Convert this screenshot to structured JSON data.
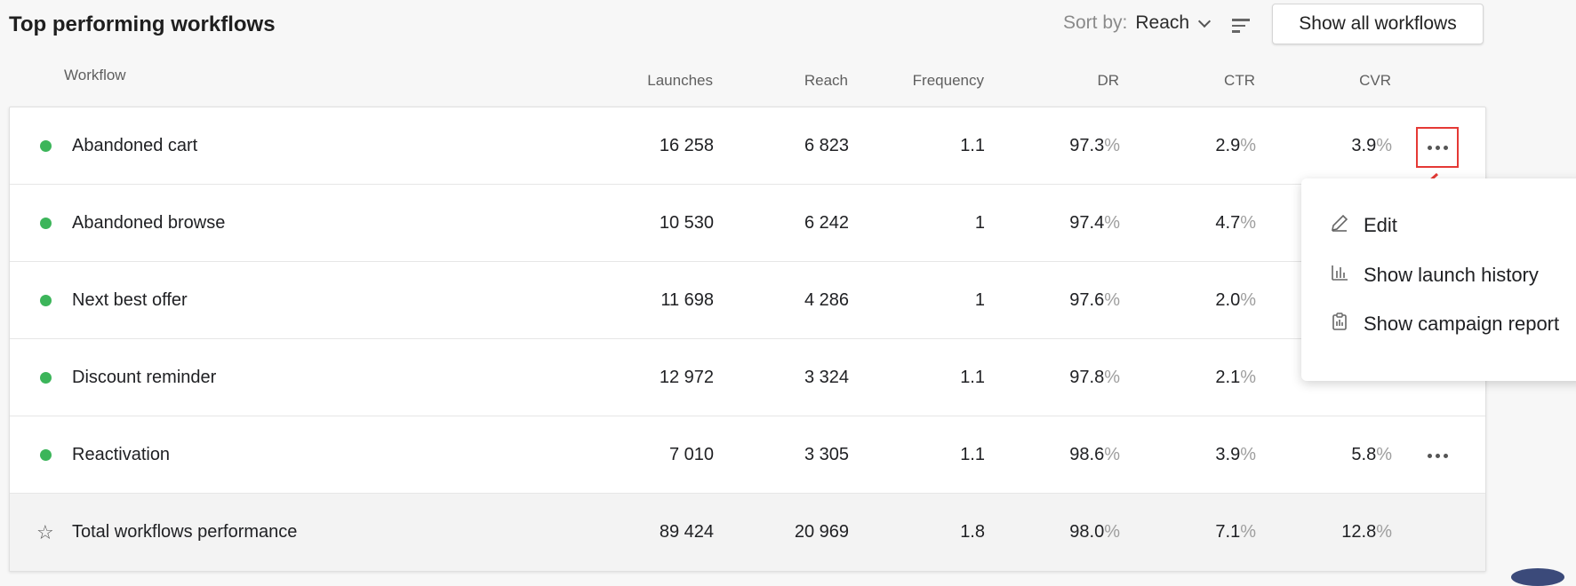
{
  "header": {
    "title": "Top performing workflows",
    "sort_label": "Sort by:",
    "sort_value": "Reach",
    "show_all": "Show all workflows"
  },
  "columns": {
    "workflow": "Workflow",
    "launches": "Launches",
    "reach": "Reach",
    "frequency": "Frequency",
    "dr": "DR",
    "ctr": "CTR",
    "cvr": "CVR"
  },
  "rows": [
    {
      "name": "Abandoned cart",
      "launches": "16 258",
      "reach": "6 823",
      "frequency": "1.1",
      "dr": "97.3",
      "ctr": "2.9",
      "cvr": "3.9"
    },
    {
      "name": "Abandoned browse",
      "launches": "10 530",
      "reach": "6 242",
      "frequency": "1",
      "dr": "97.4",
      "ctr": "4.7",
      "cvr": ""
    },
    {
      "name": "Next best offer",
      "launches": "11 698",
      "reach": "4 286",
      "frequency": "1",
      "dr": "97.6",
      "ctr": "2.0",
      "cvr": ""
    },
    {
      "name": "Discount reminder",
      "launches": "12 972",
      "reach": "3 324",
      "frequency": "1.1",
      "dr": "97.8",
      "ctr": "2.1",
      "cvr": ""
    },
    {
      "name": "Reactivation",
      "launches": "7 010",
      "reach": "3 305",
      "frequency": "1.1",
      "dr": "98.6",
      "ctr": "3.9",
      "cvr": "5.8"
    }
  ],
  "total": {
    "name": "Total workflows performance",
    "launches": "89 424",
    "reach": "20 969",
    "frequency": "1.8",
    "dr": "98.0",
    "ctr": "7.1",
    "cvr": "12.8"
  },
  "percent_sign": "%",
  "menu": {
    "edit": "Edit",
    "launch_history": "Show launch history",
    "campaign_report": "Show campaign report"
  },
  "colors": {
    "active_dot": "#3cb55a",
    "highlight": "#e53935"
  },
  "icons": {
    "sort": "sort-lines-icon",
    "more": "more-horizontal-icon",
    "edit": "pencil-icon",
    "history": "bar-chart-icon",
    "report": "clipboard-icon",
    "total": "star-icon"
  }
}
